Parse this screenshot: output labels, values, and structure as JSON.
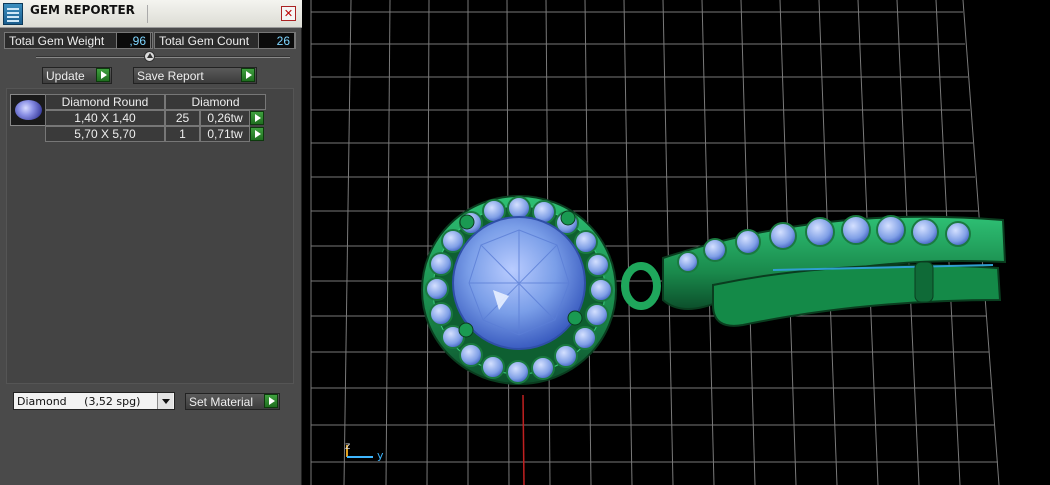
{
  "panel": {
    "title": "GEM REPORTER",
    "close_icon": "close-icon",
    "total_weight_label": "Total Gem Weight",
    "total_weight_value": ",96",
    "total_count_label": "Total Gem Count",
    "total_count_value": "26",
    "update_label": "Update",
    "save_report_label": "Save Report",
    "gem_table": {
      "headers": [
        "Diamond Round",
        "Diamond"
      ],
      "rows": [
        {
          "size": "1,40 X 1,40",
          "count": "25",
          "weight": "0,26tw"
        },
        {
          "size": "5,70 X 5,70",
          "count": "1",
          "weight": "0,71tw"
        }
      ]
    },
    "material_select": "Diamond     (3,52 spg)",
    "set_material_label": "Set Material"
  },
  "viewport": {
    "axis_z": "z",
    "axis_y": "y",
    "colors": {
      "metal": "#1f8f4f",
      "gem": "#7a9ee8",
      "grid": "#9a9a9a"
    }
  }
}
